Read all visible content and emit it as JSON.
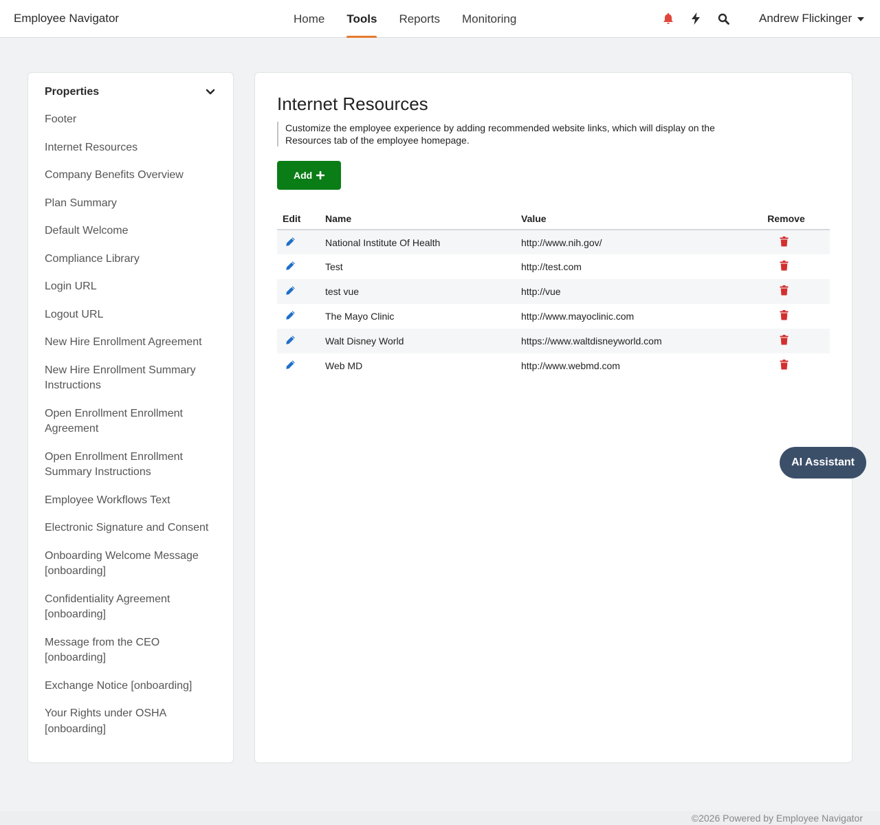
{
  "app": {
    "brand": "Employee Navigator"
  },
  "nav": {
    "items": [
      {
        "label": "Home",
        "active": false
      },
      {
        "label": "Tools",
        "active": true
      },
      {
        "label": "Reports",
        "active": false
      },
      {
        "label": "Monitoring",
        "active": false
      }
    ],
    "accent_color": "#e57a2e"
  },
  "header_icons": [
    "bell-icon",
    "bolt-icon",
    "search-icon"
  ],
  "user": {
    "name": "Andrew Flickinger"
  },
  "sidebar": {
    "title": "Properties",
    "items": [
      "Footer",
      "Internet Resources",
      "Company Benefits Overview",
      "Plan Summary",
      "Default Welcome",
      "Compliance Library",
      "Login URL",
      "Logout URL",
      "New Hire Enrollment Agreement",
      "New Hire Enrollment Summary Instructions",
      "Open Enrollment Enrollment Agreement",
      "Open Enrollment Enrollment Summary Instructions",
      "Employee Workflows Text",
      "Electronic Signature and Consent",
      "Onboarding Welcome Message [onboarding]",
      "Confidentiality Agreement [onboarding]",
      "Message from the CEO [onboarding]",
      "Exchange Notice [onboarding]",
      "Your Rights under OSHA [onboarding]"
    ]
  },
  "main": {
    "title": "Internet Resources",
    "description": "Customize the employee experience by adding recommended website links, which will display on the Resources tab of the employee homepage.",
    "add_label": "Add",
    "table": {
      "headers": {
        "edit": "Edit",
        "name": "Name",
        "value": "Value",
        "remove": "Remove"
      },
      "rows": [
        {
          "name": "National Institute Of Health",
          "value": "http://www.nih.gov/"
        },
        {
          "name": "Test",
          "value": "http://test.com"
        },
        {
          "name": "test vue",
          "value": "http://vue"
        },
        {
          "name": "The Mayo Clinic",
          "value": "http://www.mayoclinic.com"
        },
        {
          "name": "Walt Disney World",
          "value": "https://www.waltdisneyworld.com"
        },
        {
          "name": "Web MD",
          "value": "http://www.webmd.com"
        }
      ]
    }
  },
  "ai_assistant": {
    "label": "AI Assistant"
  },
  "footer": {
    "text": "©2026 Powered by Employee Navigator"
  },
  "colors": {
    "add_button": "#0a7d16",
    "edit_icon": "#1f6fc9",
    "delete_icon": "#d32f2f",
    "bell_icon": "#e0463c",
    "ai_button": "#3c4f69"
  }
}
